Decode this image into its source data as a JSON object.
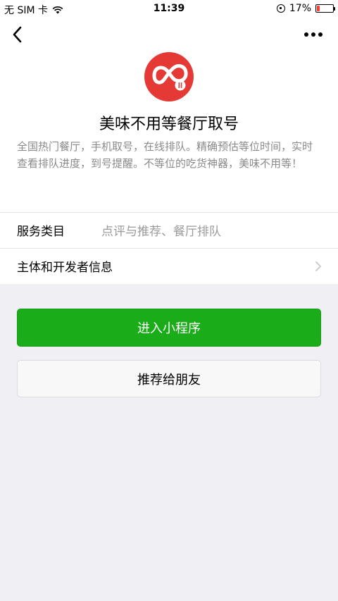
{
  "status_bar": {
    "carrier": "无 SIM 卡",
    "time": "11:39",
    "battery_percent_text": "17%",
    "battery_level": 0.17,
    "battery_color": "#ff3b30"
  },
  "nav": {
    "back_icon": "chevron-left-icon",
    "more_icon": "more-dots-icon"
  },
  "app": {
    "logo_icon": "restaurant-logo-icon",
    "logo_color": "#e53935",
    "name": "美味不用等餐厅取号",
    "description": "全国热门餐厅，手机取号，在线排队。精确预估等位时间，实时查看排队进度，到号提醒。不等位的吃货神器，美味不用等！"
  },
  "info_rows": {
    "service_category_label": "服务类目",
    "service_category_value": "点评与推荐、餐厅排队",
    "developer_info_label": "主体和开发者信息"
  },
  "actions": {
    "enter_label": "进入小程序",
    "recommend_label": "推荐给朋友",
    "primary_color": "#1aad19"
  }
}
